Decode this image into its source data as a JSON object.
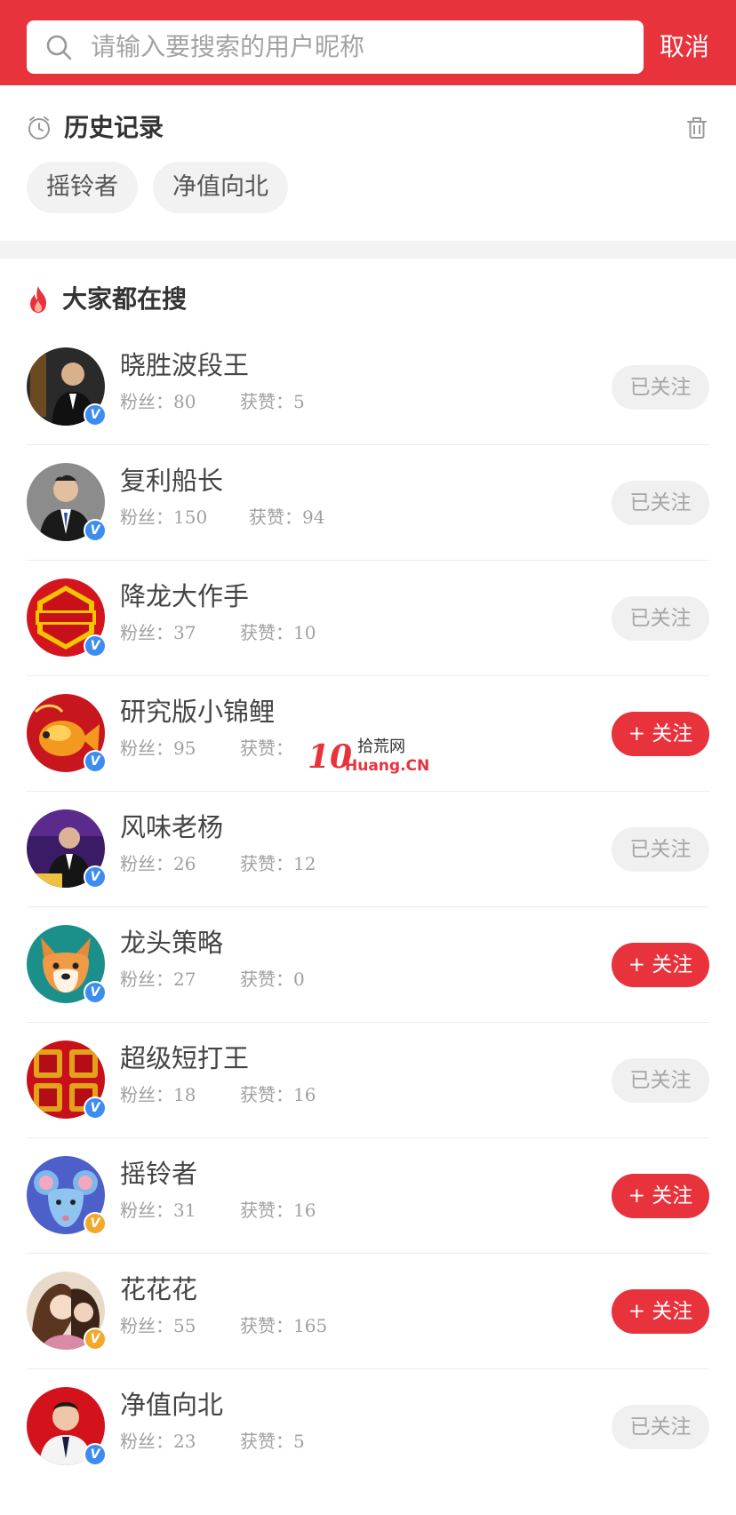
{
  "search": {
    "placeholder": "请输入要搜索的用户昵称",
    "cancel_label": "取消"
  },
  "history": {
    "title": "历史记录",
    "items": [
      "摇铃者",
      "净值向北"
    ]
  },
  "hot": {
    "title": "大家都在搜",
    "users": [
      {
        "name": "晓胜波段王",
        "fans_label": "粉丝：80",
        "likes_label": "获赞：5",
        "button": "已关注",
        "followed": true,
        "verify": "blue"
      },
      {
        "name": "复利船长",
        "fans_label": "粉丝：150",
        "likes_label": "获赞：94",
        "button": "已关注",
        "followed": true,
        "verify": "blue"
      },
      {
        "name": "降龙大作手",
        "fans_label": "粉丝：37",
        "likes_label": "获赞：10",
        "button": "已关注",
        "followed": true,
        "verify": "blue"
      },
      {
        "name": "研究版小锦鲤",
        "fans_label": "粉丝：95",
        "likes_label": "获赞：",
        "button": "+ 关注",
        "followed": false,
        "verify": "blue"
      },
      {
        "name": "风味老杨",
        "fans_label": "粉丝：26",
        "likes_label": "获赞：12",
        "button": "已关注",
        "followed": true,
        "verify": "blue"
      },
      {
        "name": "龙头策略",
        "fans_label": "粉丝：27",
        "likes_label": "获赞：0",
        "button": "+ 关注",
        "followed": false,
        "verify": "blue"
      },
      {
        "name": "超级短打王",
        "fans_label": "粉丝：18",
        "likes_label": "获赞：16",
        "button": "已关注",
        "followed": true,
        "verify": "blue"
      },
      {
        "name": "摇铃者",
        "fans_label": "粉丝：31",
        "likes_label": "获赞：16",
        "button": "+ 关注",
        "followed": false,
        "verify": "gold"
      },
      {
        "name": "花花花",
        "fans_label": "粉丝：55",
        "likes_label": "获赞：165",
        "button": "+ 关注",
        "followed": false,
        "verify": "gold"
      },
      {
        "name": "净值向北",
        "fans_label": "粉丝：23",
        "likes_label": "获赞：5",
        "button": "已关注",
        "followed": true,
        "verify": "blue"
      }
    ]
  },
  "watermark": {
    "logo": "10",
    "line1": "拾荒网",
    "line2": "Huang.CN"
  },
  "colors": {
    "brand_red": "#e8323c",
    "verify_blue": "#3d8cf0",
    "verify_gold": "#f0a92b"
  }
}
